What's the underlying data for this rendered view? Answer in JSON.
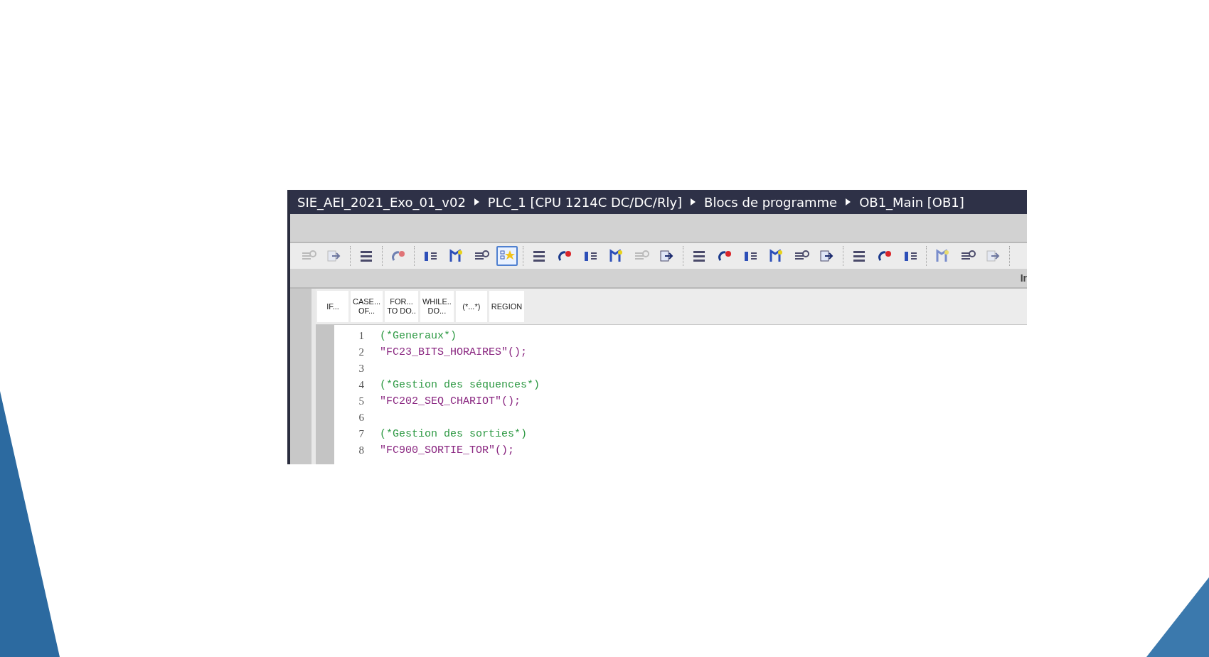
{
  "breadcrumb": [
    "SIE_AEI_2021_Exo_01_v02",
    "PLC_1 [CPU 1214C DC/DC/Rly]",
    "Blocs de programme",
    "OB1_Main [OB1]"
  ],
  "toolbar": [
    [
      {
        "disabled": true,
        "selected": false
      },
      {
        "disabled": true,
        "selected": false
      }
    ],
    [
      {
        "disabled": false,
        "selected": false
      }
    ],
    [
      {
        "disabled": true,
        "selected": false
      }
    ],
    [
      {
        "disabled": false,
        "selected": false
      },
      {
        "disabled": false,
        "selected": false
      },
      {
        "disabled": false,
        "selected": false
      },
      {
        "disabled": false,
        "selected": true
      }
    ],
    [
      {
        "disabled": false,
        "selected": false
      },
      {
        "disabled": false,
        "selected": false
      },
      {
        "disabled": false,
        "selected": false
      },
      {
        "disabled": false,
        "selected": false
      },
      {
        "disabled": true,
        "selected": false
      },
      {
        "disabled": false,
        "selected": false
      }
    ],
    [
      {
        "disabled": false,
        "selected": false
      },
      {
        "disabled": false,
        "selected": false
      },
      {
        "disabled": false,
        "selected": false
      },
      {
        "disabled": false,
        "selected": false
      },
      {
        "disabled": false,
        "selected": false
      },
      {
        "disabled": false,
        "selected": false
      }
    ],
    [
      {
        "disabled": false,
        "selected": false
      },
      {
        "disabled": false,
        "selected": false
      },
      {
        "disabled": false,
        "selected": false
      }
    ],
    [
      {
        "disabled": true,
        "selected": false
      },
      {
        "disabled": false,
        "selected": false
      },
      {
        "disabled": true,
        "selected": false
      }
    ]
  ],
  "band_text": "Ir",
  "keywords": [
    [
      "IF..."
    ],
    [
      "CASE...",
      "OF..."
    ],
    [
      "FOR...",
      "TO DO.."
    ],
    [
      "WHILE..",
      "DO..."
    ],
    [
      "(*...*)"
    ],
    [
      "REGION"
    ]
  ],
  "code_lines": [
    {
      "number": "1",
      "kind": "comment",
      "text": "(*Generaux*)"
    },
    {
      "number": "2",
      "kind": "call",
      "text": "\"FC23_BITS_HORAIRES\"();"
    },
    {
      "number": "3",
      "kind": "blank"
    },
    {
      "number": "4",
      "kind": "comment",
      "text": "(*Gestion des séquences*)"
    },
    {
      "number": "5",
      "kind": "call",
      "text": "\"FC202_SEQ_CHARIOT\"();"
    },
    {
      "number": "6",
      "kind": "blank"
    },
    {
      "number": "7",
      "kind": "comment",
      "text": "(*Gestion des sorties*)"
    },
    {
      "number": "8",
      "kind": "call",
      "text": "\"FC900_SORTIE_TOR\"();"
    }
  ]
}
